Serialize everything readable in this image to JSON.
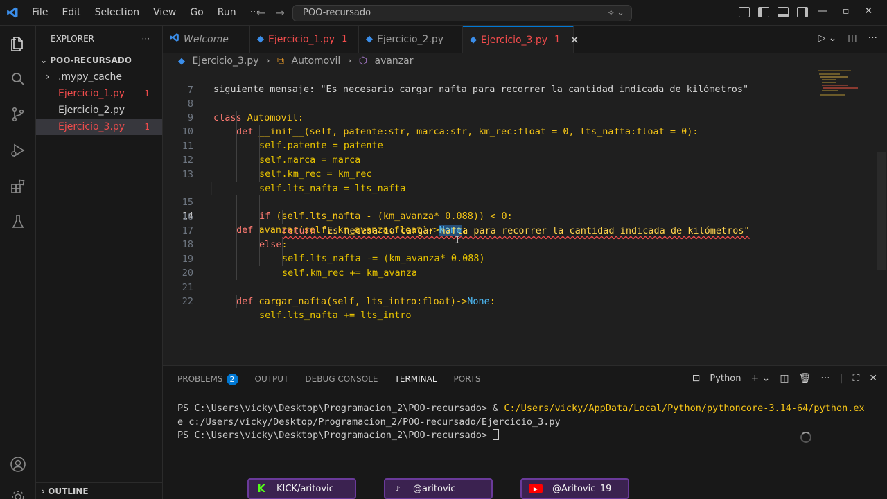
{
  "titlebar": {
    "menu": [
      "File",
      "Edit",
      "Selection",
      "View",
      "Go",
      "Run",
      "···"
    ],
    "search": "POO-recursado"
  },
  "sidebar": {
    "title": "EXPLORER",
    "folder": "POO-RECURSADO",
    "items": [
      {
        "label": ".mypy_cache",
        "errors": ""
      },
      {
        "label": "Ejercicio_1.py",
        "errors": "1"
      },
      {
        "label": "Ejercicio_2.py",
        "errors": ""
      },
      {
        "label": "Ejercicio_3.py",
        "errors": "1"
      }
    ],
    "outline": "OUTLINE"
  },
  "tabs": [
    {
      "label": "Welcome",
      "num": ""
    },
    {
      "label": "Ejercicio_1.py",
      "num": "1"
    },
    {
      "label": "Ejercicio_2.py",
      "num": ""
    },
    {
      "label": "Ejercicio_3.py",
      "num": "1"
    }
  ],
  "breadcrumb": [
    "Ejercicio_3.py",
    "Automovil",
    "avanzar"
  ],
  "editor": {
    "sticky": "siguiente mensaje: \"Es necesario cargar nafta para recorrer la cantidad indicada de kilómetros\"",
    "lines": [
      {
        "n": "7"
      },
      {
        "n": "8"
      },
      {
        "n": "9"
      },
      {
        "n": "10"
      },
      {
        "n": "11"
      },
      {
        "n": "12"
      },
      {
        "n": "13"
      },
      {
        "n": "14"
      },
      {
        "n": "15"
      },
      {
        "n": "16"
      },
      {
        "n": "17"
      },
      {
        "n": "18"
      },
      {
        "n": "19"
      },
      {
        "n": "20"
      },
      {
        "n": "21"
      },
      {
        "n": "22"
      }
    ],
    "code": {
      "l8": [
        "class",
        " Automovil:"
      ],
      "l9": [
        "def",
        " __init__(self, patente:str, marca:str, km_rec:float = 0, lts_nafta:float = 0):"
      ],
      "l10": "self.patente = patente",
      "l11": "self.marca = marca",
      "l12": "self.km_rec = km_rec",
      "l13": "self.lts_nafta = lts_nafta",
      "l14": [
        "def",
        " avanzar(self, km_avanza:float)->",
        "None",
        ":"
      ],
      "l15": [
        "if",
        " (self.lts_nafta - (km_avanza* 0.088)) < 0:"
      ],
      "l16": [
        "return",
        " ",
        "\"Es necesario cargar nafta para recorrer la cantidad indicada de kilómetros\""
      ],
      "l17": [
        "else",
        ":"
      ],
      "l18": "self.lts_nafta -= (km_avanza* 0.088)",
      "l19": "self.km_rec += km_avanza",
      "l21": [
        "def",
        " cargar_nafta(self, lts_intro:float)->",
        "None",
        ":"
      ],
      "l22": "self.lts_nafta += lts_intro"
    }
  },
  "panel": {
    "tabs": [
      {
        "label": "PROBLEMS",
        "badge": "2"
      },
      {
        "label": "OUTPUT",
        "badge": ""
      },
      {
        "label": "DEBUG CONSOLE",
        "badge": ""
      },
      {
        "label": "TERMINAL",
        "badge": ""
      },
      {
        "label": "PORTS",
        "badge": ""
      }
    ],
    "shell": "Python",
    "terminal": {
      "l1_prompt": "PS C:\\Users\\vicky\\Desktop\\Programacion_2\\POO-recursado> & ",
      "l1_path": "C:/Users/vicky/AppData/Local/Python/pythoncore-3.14-64/python.ex",
      "l2": "e c:/Users/vicky/Desktop/Programacion_2/POO-recursado/Ejercicio_3.py",
      "l3": "PS C:\\Users\\vicky\\Desktop\\Programacion_2\\POO-recursado> "
    }
  },
  "social": [
    {
      "label": "KICK/aritovic",
      "icon": "kick-icon",
      "color": "#53fc18"
    },
    {
      "label": "@aritovic_",
      "icon": "tiktok-icon",
      "color": "#ffffff"
    },
    {
      "label": "@Aritovic_19",
      "icon": "youtube-icon",
      "color": "#ff0000"
    }
  ]
}
